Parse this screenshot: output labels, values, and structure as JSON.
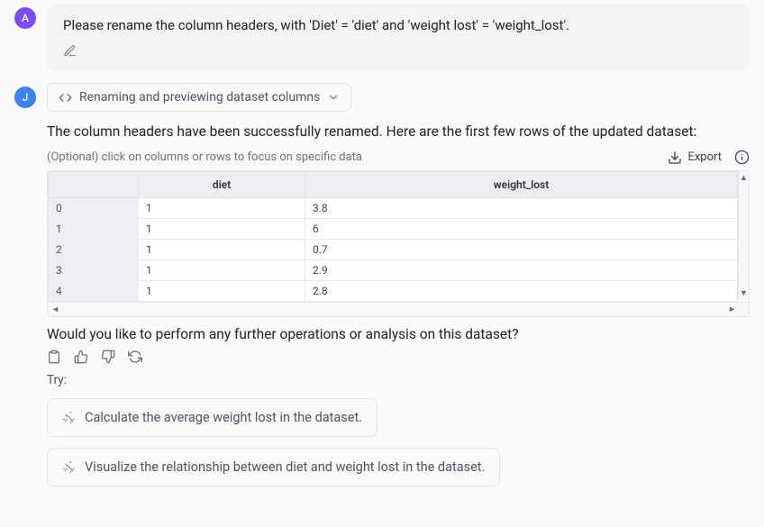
{
  "user": {
    "initial": "A",
    "message": "Please rename the column headers, with 'Diet' = 'diet' and 'weight lost' = 'weight_lost'."
  },
  "assistant": {
    "initial": "J",
    "tool_label": "Renaming and previewing dataset columns",
    "response": "The column headers have been successfully renamed. Here are the first few rows of the updated dataset:",
    "hint": "(Optional) click on columns or rows to focus on specific data",
    "export_label": "Export",
    "followup": "Would you like to perform any further operations or analysis on this dataset?",
    "try_label": "Try:"
  },
  "table": {
    "headers": [
      "",
      "diet",
      "weight_lost"
    ],
    "rows": [
      {
        "index": "0",
        "diet": "1",
        "weight_lost": "3.8"
      },
      {
        "index": "1",
        "diet": "1",
        "weight_lost": "6"
      },
      {
        "index": "2",
        "diet": "1",
        "weight_lost": "0.7"
      },
      {
        "index": "3",
        "diet": "1",
        "weight_lost": "2.9"
      },
      {
        "index": "4",
        "diet": "1",
        "weight_lost": "2.8"
      }
    ]
  },
  "suggestions": [
    "Calculate the average weight lost in the dataset.",
    "Visualize the relationship between diet and weight lost in the dataset."
  ]
}
